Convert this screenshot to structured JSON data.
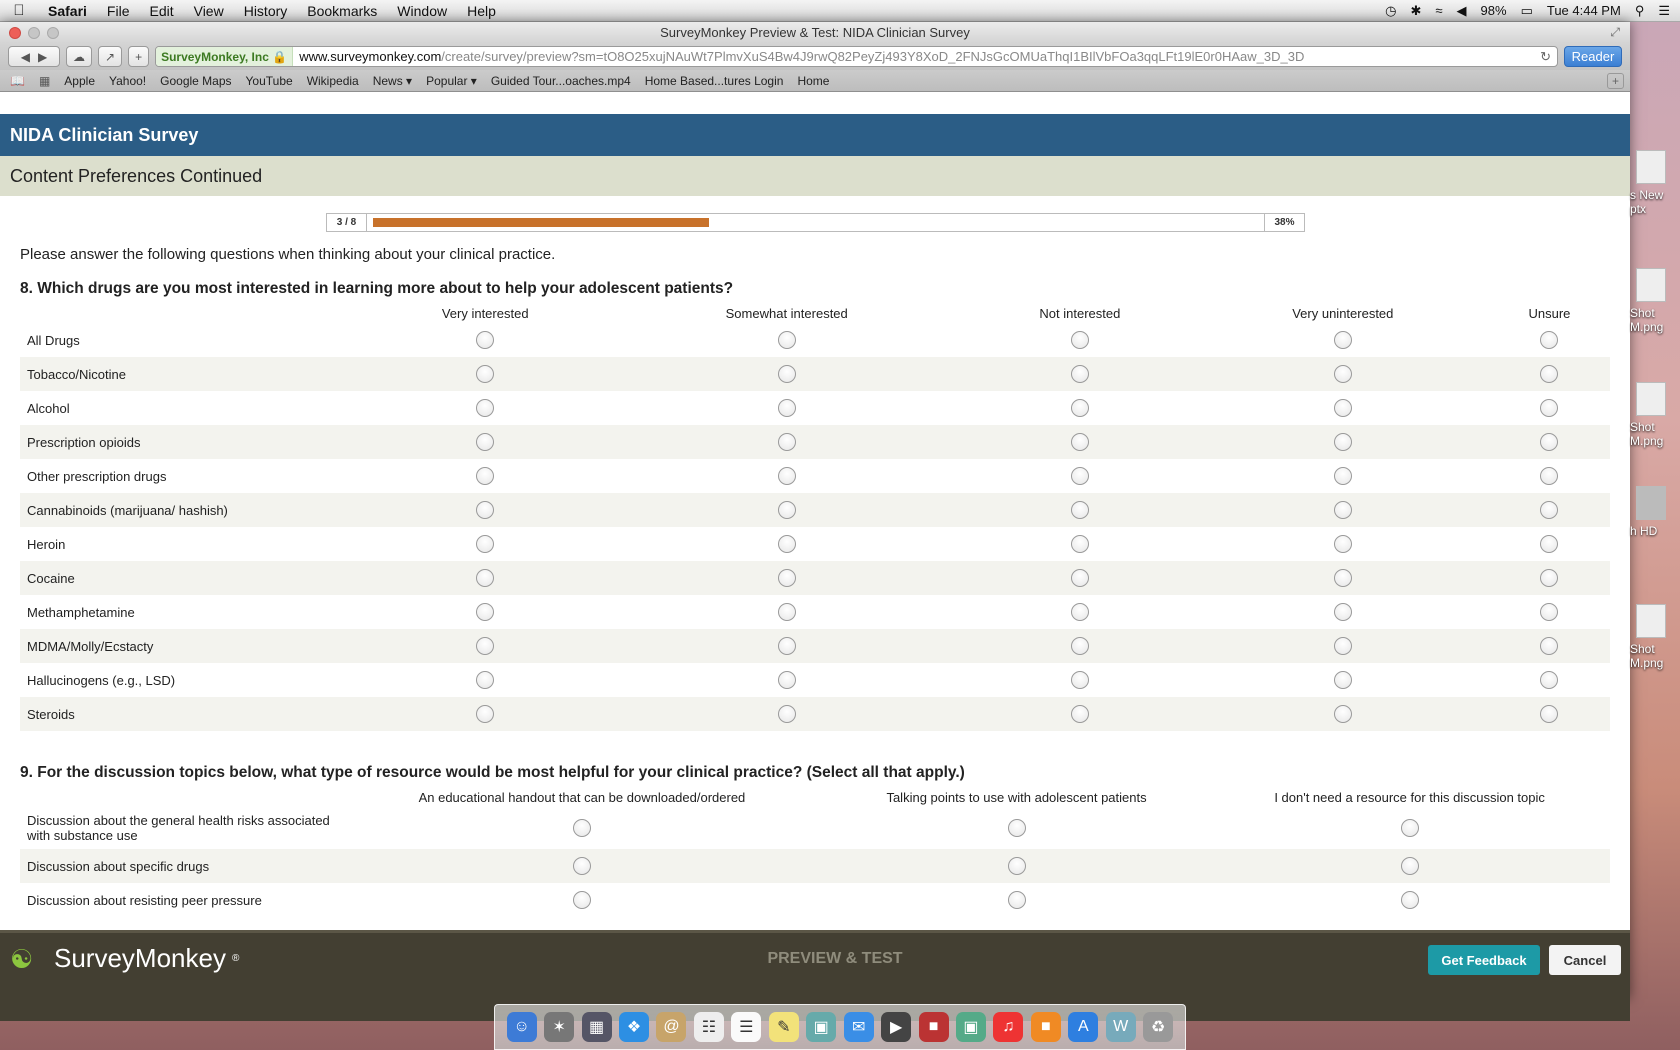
{
  "menubar": {
    "app": "Safari",
    "menus": [
      "File",
      "Edit",
      "View",
      "History",
      "Bookmarks",
      "Window",
      "Help"
    ],
    "battery": "98%",
    "clock": "Tue 4:44 PM"
  },
  "window": {
    "title": "SurveyMonkey Preview & Test: NIDA Clinician Survey"
  },
  "toolbar": {
    "secure_label": "SurveyMonkey, Inc",
    "url_host": "www.surveymonkey.com",
    "url_path": "/create/survey/preview?sm=tO8O25xujNAuWt7PlmvXuS4Bw4J9rwQ82PeyZj493Y8XoD_2FNJsGcOMUaThqI1BIlVbFOa3qqLFt19lE0r0HAaw_3D_3D",
    "reader_label": "Reader"
  },
  "bookmarks": [
    "Apple",
    "Yahoo!",
    "Google Maps",
    "YouTube",
    "Wikipedia",
    "News ▾",
    "Popular ▾",
    "Guided Tour...oaches.mp4",
    "Home Based...tures Login",
    "Home"
  ],
  "survey": {
    "name": "NIDA Clinician Survey",
    "page_title": "Content Preferences Continued",
    "progress_count": "3 / 8",
    "progress_percent_label": "38%",
    "progress_fraction": 0.38,
    "intro": "Please answer the following questions when thinking about your clinical practice.",
    "q8": {
      "title": "8. Which drugs are you most interested in learning more about to help your adolescent patients?",
      "columns": [
        "Very interested",
        "Somewhat interested",
        "Not interested",
        "Very uninterested",
        "Unsure"
      ],
      "rows": [
        "All Drugs",
        "Tobacco/Nicotine",
        "Alcohol",
        "Prescription opioids",
        "Other prescription drugs",
        "Cannabinoids (marijuana/ hashish)",
        "Heroin",
        "Cocaine",
        "Methamphetamine",
        "MDMA/Molly/Ecstacty",
        "Hallucinogens (e.g., LSD)",
        "Steroids"
      ]
    },
    "q9": {
      "title": "9. For the discussion topics below, what type of resource would be most helpful for your clinical practice? (Select all that apply.)",
      "columns": [
        "An educational handout that can be downloaded/ordered",
        "Talking points to use with adolescent patients",
        "I don't need a resource for this discussion topic"
      ],
      "rows": [
        "Discussion about the general health risks associated with substance use",
        "Discussion about specific drugs",
        "Discussion about resisting peer pressure"
      ]
    }
  },
  "footer": {
    "brand": "SurveyMonkey",
    "mode": "PREVIEW & TEST",
    "feedback_label": "Get Feedback",
    "cancel_label": "Cancel"
  },
  "desktop": {
    "icons": [
      "s New\nptx",
      "Shot\nM.png",
      "Shot\nM.png",
      "h HD",
      "Shot\nM.png"
    ]
  }
}
